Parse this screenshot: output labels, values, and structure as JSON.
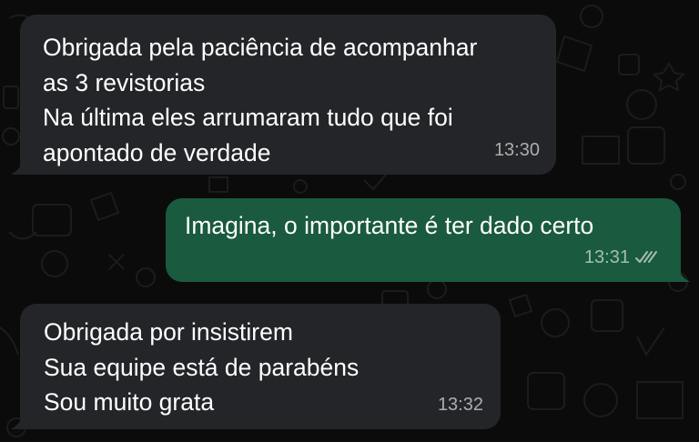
{
  "conversation": {
    "messages": [
      {
        "direction": "incoming",
        "lines": [
          "Obrigada pela paciência de acompanhar",
          "as 3 revistorias",
          "Na última eles arrumaram tudo que foi",
          "apontado de verdade"
        ],
        "time": "13:30"
      },
      {
        "direction": "outgoing",
        "lines": [
          "Imagina, o importante é ter dado certo"
        ],
        "time": "13:31",
        "status_icon": "double-check-icon"
      },
      {
        "direction": "incoming",
        "lines": [
          "Obrigada por insistirem",
          "Sua equipe está de parabéns",
          "Sou muito grata"
        ],
        "time": "13:32"
      }
    ]
  },
  "colors": {
    "background": "#0b0b0b",
    "incoming_bubble": "#232528",
    "outgoing_bubble": "#1a5a3e",
    "text": "#ffffff"
  },
  "icons": [
    "double-check-icon",
    "chat-wallpaper-doodles"
  ]
}
